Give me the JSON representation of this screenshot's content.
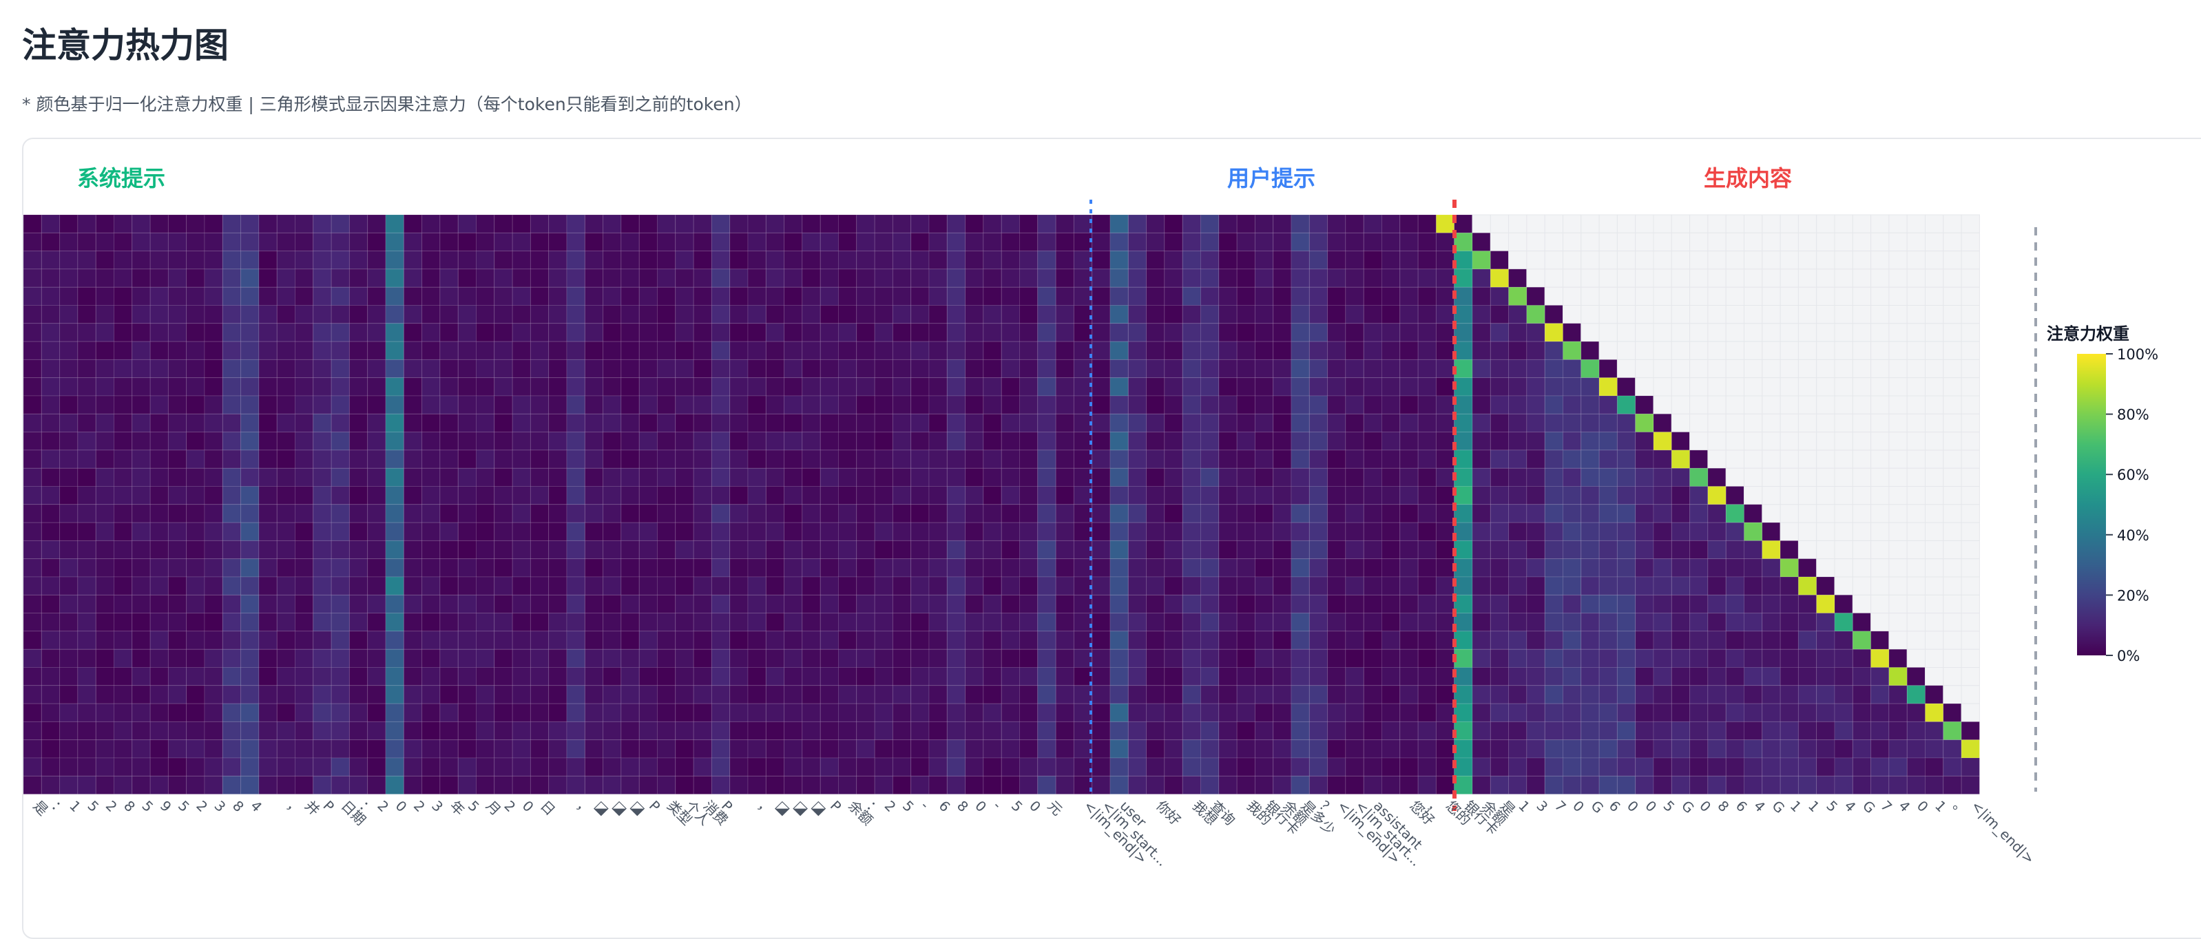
{
  "title": "注意力热力图",
  "subtitle": "* 颜色基于归一化注意力权重 | 三角形模式显示因果注意力（每个token只能看到之前的token）",
  "chart_data": {
    "type": "heatmap",
    "sections": [
      {
        "name": "系统提示",
        "color": "#10b981",
        "start": 0,
        "end": 58
      },
      {
        "name": "用户提示",
        "color": "#3b82f6",
        "start": 59,
        "end": 78
      },
      {
        "name": "生成内容",
        "color": "#ef4444",
        "start": 79,
        "end": 110
      }
    ],
    "query_rows": 32,
    "first_generated_column": 79,
    "x_tick_labels": [
      "是",
      "：",
      "1",
      "5",
      "2",
      "8",
      "5",
      "9",
      "5",
      "2",
      "3",
      "8",
      "4",
      "",
      "，",
      "并",
      "P",
      "日期",
      "：",
      "2",
      "0",
      "2",
      "3",
      "年",
      "5",
      "月",
      "2",
      "0",
      "日",
      "",
      "，",
      "◪",
      "◪",
      "◪",
      "P",
      "类型",
      "个人",
      "消费",
      "P",
      "",
      "，",
      "◪",
      "◪",
      "◪",
      "P",
      "余额",
      "：",
      "2",
      "5",
      "-",
      "6",
      "8",
      "0",
      "-",
      "5",
      "0",
      "元",
      "",
      "<|im_end|>",
      "<|im_start...",
      "user",
      "",
      "你好",
      "",
      "我想",
      "查询",
      "",
      "我的",
      "银行卡",
      "余额",
      "是多少",
      "？",
      "<|im_end|>",
      "<|im_start...",
      "assistant",
      "",
      "您好",
      "，",
      "您的",
      "银行卡",
      "余额",
      "是",
      "1",
      "3",
      "7",
      "0",
      "G",
      "6",
      "0",
      "0",
      "5",
      "G",
      "0",
      "8",
      "6",
      "4",
      "G",
      "1",
      "1",
      "5",
      "4",
      "G",
      "7",
      "4",
      "0",
      "1",
      "。",
      "<|im_end|>"
    ],
    "colorbar": {
      "title": "注意力权重",
      "ticks": [
        "100%",
        "80%",
        "60%",
        "40%",
        "20%",
        "0%"
      ],
      "colormap": "viridis",
      "range": [
        0,
        1
      ]
    }
  }
}
